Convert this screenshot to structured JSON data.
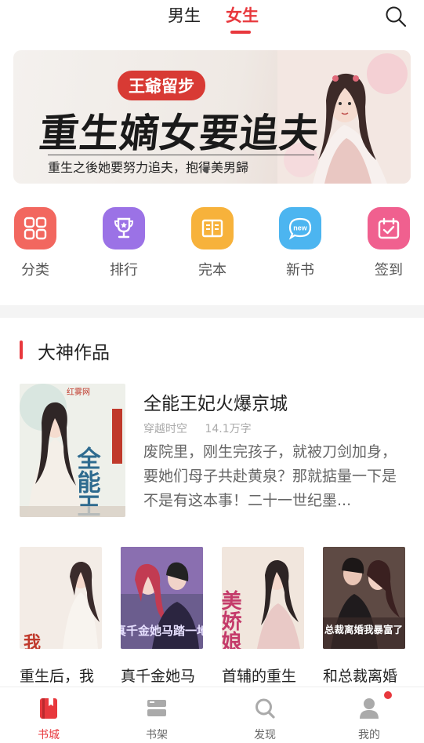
{
  "top_tabs": {
    "male": "男生",
    "female": "女生"
  },
  "banner": {
    "tag": "王爺留步",
    "title": "重生嫡女要追夫",
    "subtitle": "重生之後她要努力追夫，抱得美男歸"
  },
  "nav": [
    {
      "label": "分类",
      "icon": "grid-icon",
      "color": "#f2675f"
    },
    {
      "label": "排行",
      "icon": "trophy-icon",
      "color": "#9b72e6"
    },
    {
      "label": "完本",
      "icon": "book-open-icon",
      "color": "#f7b23b"
    },
    {
      "label": "新书",
      "icon": "new-badge-icon",
      "color": "#4cb5f0"
    },
    {
      "label": "签到",
      "icon": "calendar-check-icon",
      "color": "#f0608f"
    }
  ],
  "section": {
    "title": "大神作品"
  },
  "feature": {
    "cover_text": "全能王妃",
    "cover_brand": "红雾网",
    "title": "全能王妃火爆京城",
    "genre": "穿越时空",
    "words": "14.1万字",
    "desc": "废院里，刚生完孩子，就被刀剑加身，要她们母子共赴黄泉？那就掂量一下是不是有这本事！二十一世纪墨..."
  },
  "books": [
    {
      "title": "重生后，我",
      "cover_text": "我嫁给了节夫",
      "bg": "#f3ece6",
      "fg": "#c0392b"
    },
    {
      "title": "真千金她马",
      "cover_text": "真千金她马踏一地",
      "bg": "#6b5d8e",
      "fg": "#e7e0ff"
    },
    {
      "title": "首辅的重生",
      "cover_text": "美娇娘",
      "bg": "#f1e6dd",
      "fg": "#c43a6a"
    },
    {
      "title": "和总裁离婚",
      "cover_text": "总裁离婚我暴富了",
      "bg": "#5e4a44",
      "fg": "#fff"
    }
  ],
  "bottom_nav": [
    {
      "label": "书城",
      "icon": "bookstore-icon",
      "active": true
    },
    {
      "label": "书架",
      "icon": "bookshelf-icon",
      "active": false
    },
    {
      "label": "发现",
      "icon": "discover-icon",
      "active": false
    },
    {
      "label": "我的",
      "icon": "profile-icon",
      "active": false
    }
  ],
  "colors": {
    "accent": "#e8383d"
  }
}
